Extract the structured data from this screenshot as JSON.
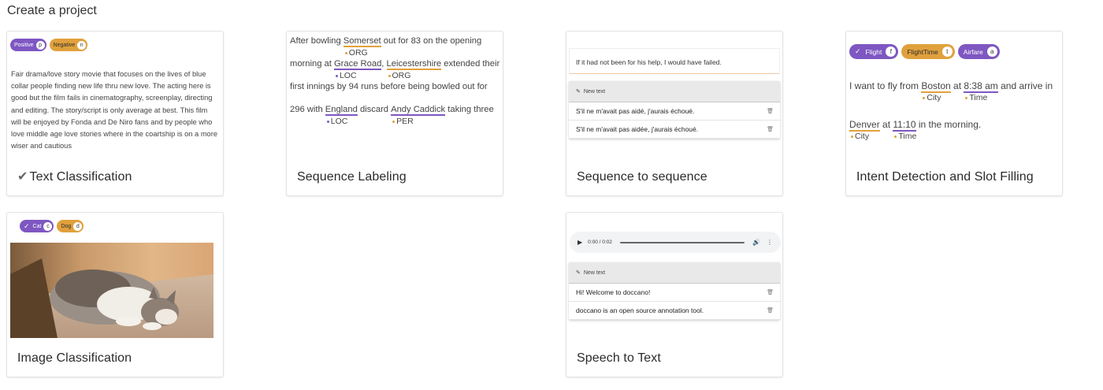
{
  "page": {
    "title": "Create a project"
  },
  "colors": {
    "purple": "#7e57c2",
    "orange": "#e0a13c"
  },
  "cards": {
    "text_classification": {
      "title": "Text Classification",
      "check_icon": "check-icon",
      "chips": [
        {
          "label": "Positive",
          "key": "p"
        },
        {
          "label": "Negative",
          "key": "n"
        }
      ],
      "text": "Fair drama/love story movie that focuses on the lives of blue collar people finding new life thru new love. The acting here is good but the film fails in cinematography, screenplay, directing and editing. The story/script is only average at best. This film will be enjoyed by Fonda and De Niro fans and by people who love middle age love stories where in the coartship is on a more wiser and cautious"
    },
    "sequence_labeling": {
      "title": "Sequence Labeling",
      "line1": {
        "pre": "After bowling ",
        "ent": "Somerset",
        "post": " out for 83 on the opening",
        "tag": "ORG"
      },
      "line2": {
        "pre": "morning at ",
        "ent1": "Grace Road",
        "tag1": "LOC",
        "mid": ", ",
        "ent2": "Leicestershire",
        "tag2": "ORG",
        "post": " extended their"
      },
      "line3": {
        "text": "first innings by 94 runs before being bowled out for"
      },
      "line4": {
        "pre": "296 with ",
        "ent1": "England",
        "tag1": "LOC",
        "mid": " discard ",
        "ent2": "Andy Caddick",
        "tag2": "PER",
        "post": " taking three"
      }
    },
    "seq2seq": {
      "title": "Sequence to sequence",
      "source": "If it had not been for his help, I would have failed.",
      "new_text_label": "New text",
      "rows": [
        "S'il ne m'avait pas aidé, j'aurais échoué.",
        "S'il ne m'avait pas aidée, j'aurais échoué."
      ]
    },
    "intent": {
      "title": "Intent Detection and Slot Filling",
      "chips": [
        {
          "label": "Flight",
          "key": "f"
        },
        {
          "label": "FlightTime",
          "key": "t"
        },
        {
          "label": "Airfare",
          "key": "a"
        }
      ],
      "line1": {
        "pre": "I want to fly from ",
        "ent1": "Boston",
        "tag1": "City",
        "mid": " at ",
        "ent2": "8:38 am",
        "tag2": "Time",
        "post": " and arrive in"
      },
      "line2": {
        "ent1": "Denver",
        "tag1": "City",
        "mid": " at ",
        "ent2": "11:10",
        "tag2": "Time",
        "post": " in the morning."
      }
    },
    "image_classification": {
      "title": "Image Classification",
      "chips": [
        {
          "label": "Cat",
          "key": "c"
        },
        {
          "label": "Dog",
          "key": "d"
        }
      ],
      "image_alt": "cat"
    },
    "speech_to_text": {
      "title": "Speech to Text",
      "audio_time": "0:00 / 0:02",
      "new_text_label": "New text",
      "rows": [
        "Hi! Welcome to doccano!",
        "doccano is an open source annotation tool."
      ]
    }
  }
}
